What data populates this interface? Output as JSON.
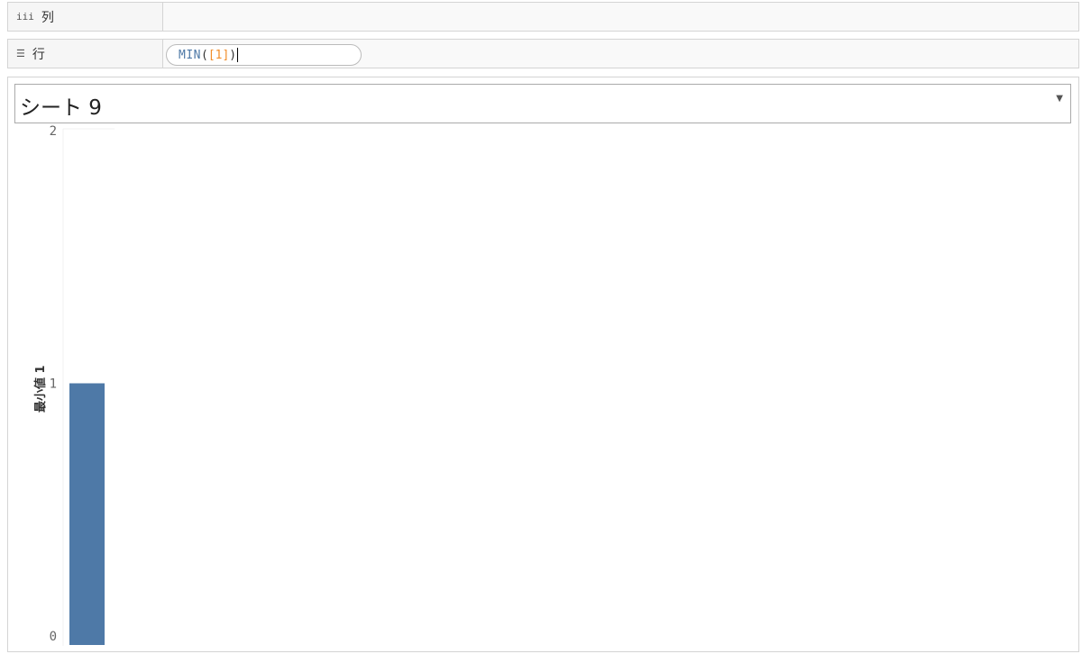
{
  "columns_shelf": {
    "icon": "iii",
    "label": "列"
  },
  "rows_shelf": {
    "icon": "☰",
    "label": "行",
    "pill": {
      "fn": "MIN",
      "open": "(",
      "field": "[1]",
      "close": ")"
    }
  },
  "sheet": {
    "title": "シート 9"
  },
  "colors": {
    "bar": "#4e79a7",
    "field": "#f28e2b",
    "fn": "#4e79a7"
  },
  "chart_data": {
    "type": "bar",
    "categories": [
      ""
    ],
    "values": [
      1
    ],
    "ylabel": "最小値 1",
    "ylim": [
      0,
      2
    ],
    "yticks": [
      "0",
      "1",
      "2"
    ],
    "grid": false
  }
}
